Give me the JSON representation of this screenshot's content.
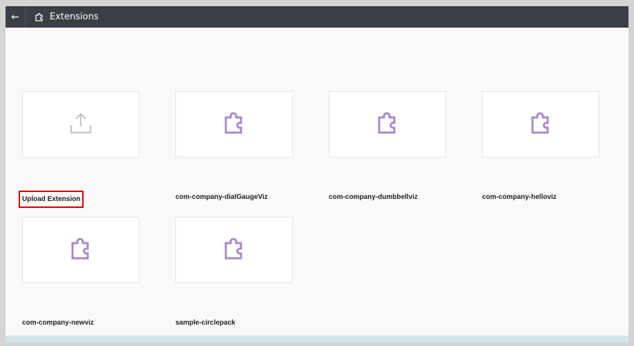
{
  "header": {
    "back_icon": "arrow-left-icon",
    "title_icon": "puzzle-icon",
    "title": "Extensions"
  },
  "upload": {
    "label": "Upload Extension",
    "icon": "upload-icon"
  },
  "extensions": [
    {
      "name": "com-company-dialGaugeViz",
      "icon": "puzzle-icon"
    },
    {
      "name": "com-company-dumbbellviz",
      "icon": "puzzle-icon"
    },
    {
      "name": "com-company-helloviz",
      "icon": "puzzle-icon"
    },
    {
      "name": "com-company-newviz",
      "icon": "puzzle-icon"
    },
    {
      "name": "sample-circlepack",
      "icon": "puzzle-icon"
    }
  ],
  "colors": {
    "header": "#3b3e44",
    "puzzle": "#a888cc",
    "highlight": "#cc0000"
  }
}
